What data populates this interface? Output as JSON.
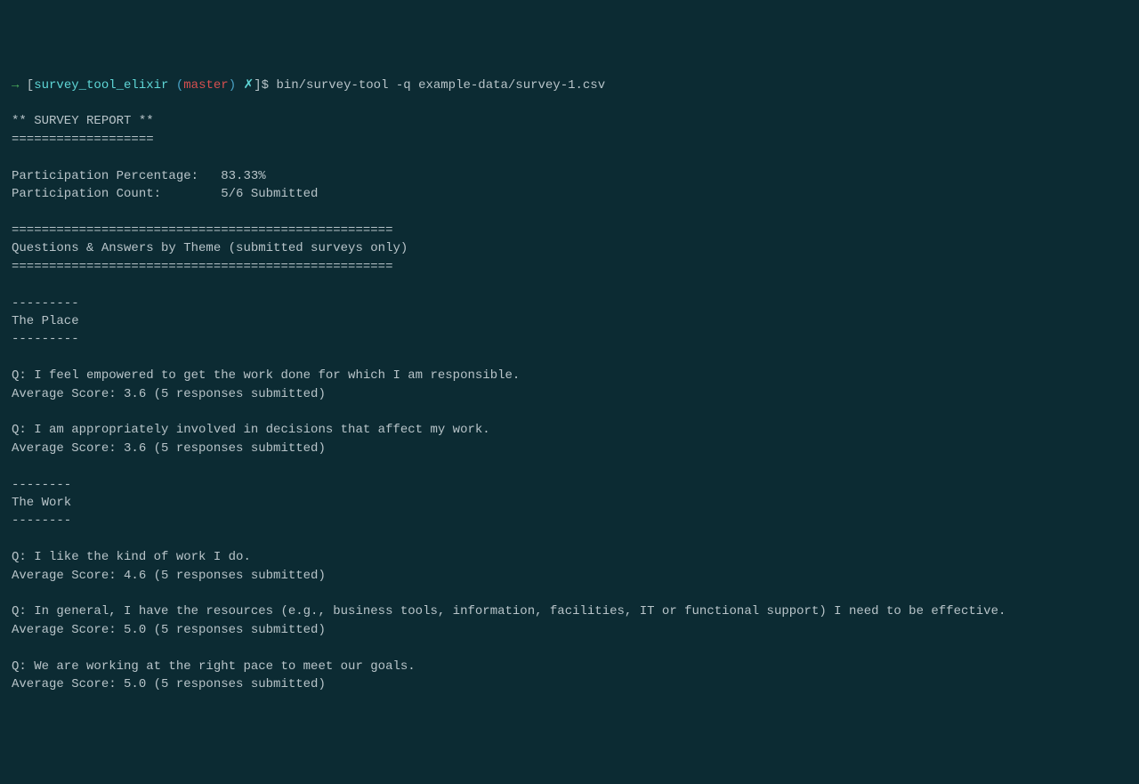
{
  "prompt": {
    "arrow": "→",
    "open_bracket": " [",
    "dir": "survey_tool_elixir",
    "git_open": " (",
    "branch": "master",
    "git_close": ")",
    "xmark": " ✗",
    "close_bracket": "]",
    "dollar": "$ ",
    "command": "bin/survey-tool -q example-data/survey-1.csv"
  },
  "output": {
    "blank1": "",
    "title": "** SURVEY REPORT **",
    "title_rule": "===================",
    "blank2": "",
    "pp_label": "Participation Percentage:   83.33%",
    "pc_label": "Participation Count:        5/6 Submitted",
    "blank3": "",
    "sec_rule1": "===================================================",
    "sec_title": "Questions & Answers by Theme (submitted surveys only)",
    "sec_rule2": "===================================================",
    "blank4": "",
    "t1_rule1": "---------",
    "t1_name": "The Place",
    "t1_rule2": "---------",
    "blank5": "",
    "t1_q1": "Q: I feel empowered to get the work done for which I am responsible.",
    "t1_a1": "Average Score: 3.6 (5 responses submitted)",
    "blank6": "",
    "t1_q2": "Q: I am appropriately involved in decisions that affect my work.",
    "t1_a2": "Average Score: 3.6 (5 responses submitted)",
    "blank7": "",
    "t2_rule1": "--------",
    "t2_name": "The Work",
    "t2_rule2": "--------",
    "blank8": "",
    "t2_q1": "Q: I like the kind of work I do.",
    "t2_a1": "Average Score: 4.6 (5 responses submitted)",
    "blank9": "",
    "t2_q2": "Q: In general, I have the resources (e.g., business tools, information, facilities, IT or functional support) I need to be effective.",
    "t2_a2": "Average Score: 5.0 (5 responses submitted)",
    "blank10": "",
    "t2_q3": "Q: We are working at the right pace to meet our goals.",
    "t2_a3": "Average Score: 5.0 (5 responses submitted)"
  }
}
